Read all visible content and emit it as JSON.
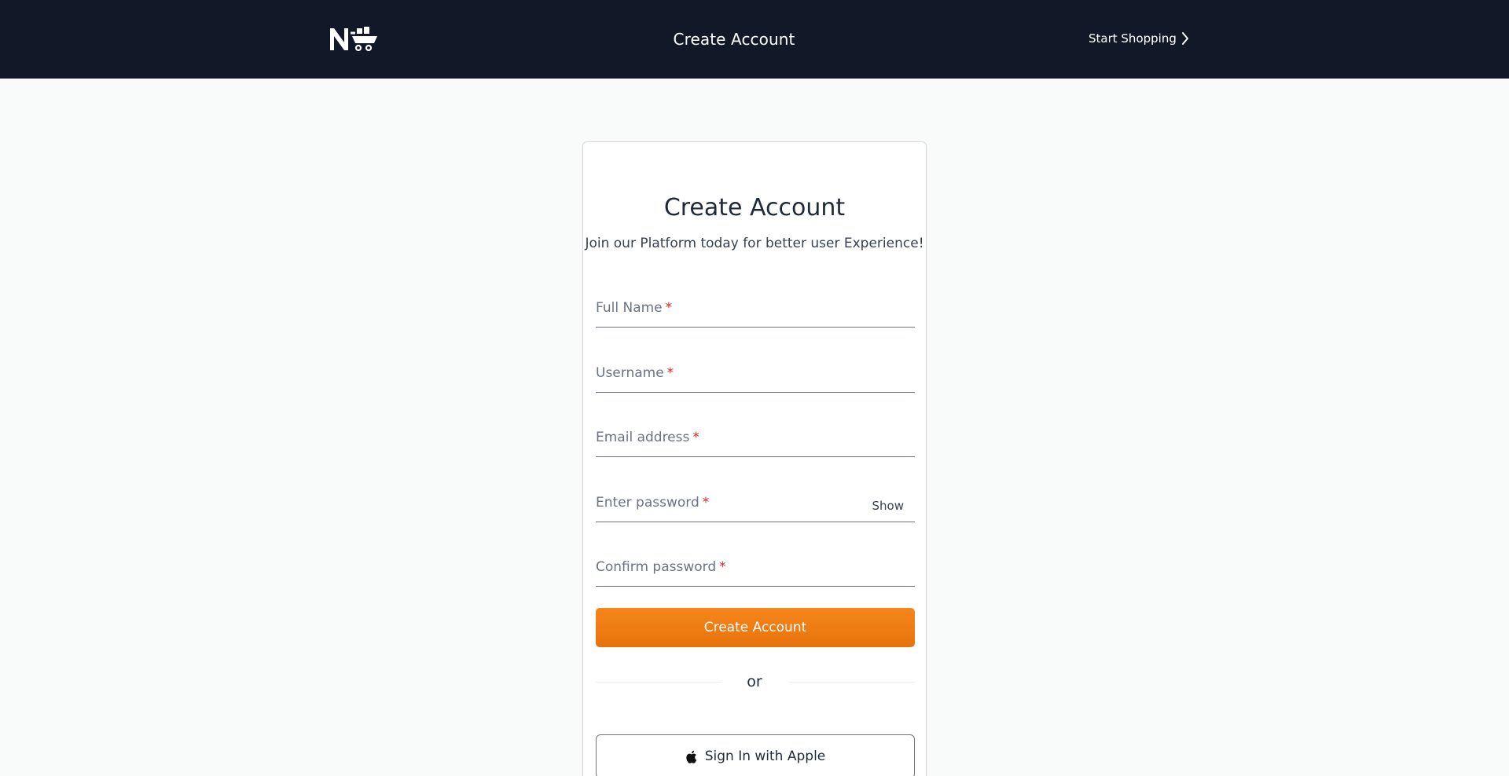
{
  "header": {
    "logo": "N-cart-logo",
    "title": "Create Account",
    "start_shopping": "Start Shopping",
    "background": "#111827"
  },
  "form": {
    "title": "Create Account",
    "subtitle": "Join our Platform today for better user Experience!",
    "fields": [
      {
        "label": "Full Name",
        "required": "*"
      },
      {
        "label": "Username",
        "required": "*"
      },
      {
        "label": "Email address",
        "required": "*"
      },
      {
        "label": "Enter password",
        "required": "*",
        "toggle": "Show"
      },
      {
        "label": "Confirm password",
        "required": "*"
      }
    ],
    "submit_label": "Create Account",
    "divider": "or",
    "apple_label": "Sign In with Apple",
    "accent": "#f5861b"
  }
}
